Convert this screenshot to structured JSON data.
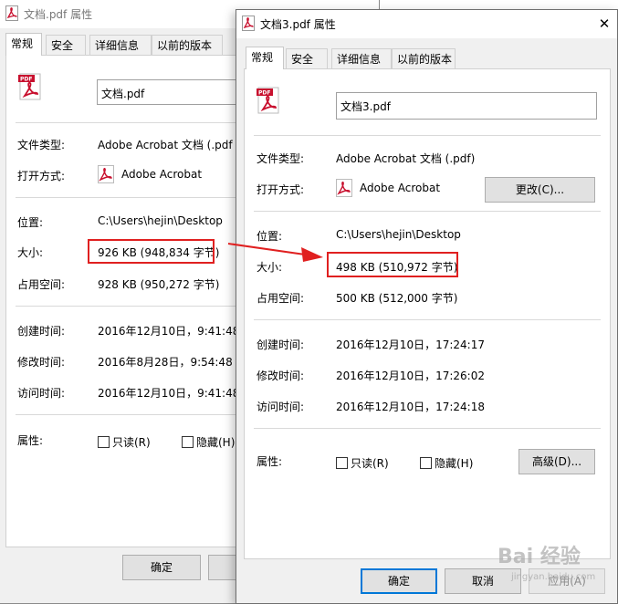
{
  "window_back": {
    "title": "文档.pdf 属性",
    "tabs": [
      "常规",
      "安全",
      "详细信息",
      "以前的版本"
    ],
    "file_name": "文档.pdf",
    "type_label": "文件类型:",
    "type_value": "Adobe Acrobat 文档 (.pdf",
    "open_label": "打开方式:",
    "open_value": "Adobe Acrobat",
    "location_label": "位置:",
    "location_value": "C:\\Users\\hejin\\Desktop",
    "size_label": "大小:",
    "size_value": "926 KB (948,834 字节)",
    "disk_label": "占用空间:",
    "disk_value": "928 KB (950,272 字节)",
    "created_label": "创建时间:",
    "created_value": "2016年12月10日，9:41:48",
    "modified_label": "修改时间:",
    "modified_value": "2016年8月28日，9:54:48",
    "accessed_label": "访问时间:",
    "accessed_value": "2016年12月10日，9:41:48",
    "attr_label": "属性:",
    "readonly_label": "只读(R)",
    "hidden_label": "隐藏(H)",
    "ok_label": "确定"
  },
  "window_front": {
    "title": "文档3.pdf 属性",
    "tabs": [
      "常规",
      "安全",
      "详细信息",
      "以前的版本"
    ],
    "file_name": "文档3.pdf",
    "type_label": "文件类型:",
    "type_value": "Adobe Acrobat 文档 (.pdf)",
    "open_label": "打开方式:",
    "open_value": "Adobe Acrobat",
    "change_button": "更改(C)...",
    "location_label": "位置:",
    "location_value": "C:\\Users\\hejin\\Desktop",
    "size_label": "大小:",
    "size_value": "498 KB (510,972 字节)",
    "disk_label": "占用空间:",
    "disk_value": "500 KB (512,000 字节)",
    "created_label": "创建时间:",
    "created_value": "2016年12月10日，17:24:17",
    "modified_label": "修改时间:",
    "modified_value": "2016年12月10日，17:26:02",
    "accessed_label": "访问时间:",
    "accessed_value": "2016年12月10日，17:24:18",
    "attr_label": "属性:",
    "readonly_label": "只读(R)",
    "hidden_label": "隐藏(H)",
    "advanced_button": "高级(D)...",
    "ok_label": "确定",
    "cancel_label": "取消",
    "apply_label": "应用(A)"
  },
  "watermark": {
    "brand": "Bai 经验",
    "url": "jingyan.baidu.com"
  },
  "colors": {
    "highlight_red": "#e02020",
    "default_button_border": "#0078d7",
    "pdf_red": "#c8102e"
  }
}
